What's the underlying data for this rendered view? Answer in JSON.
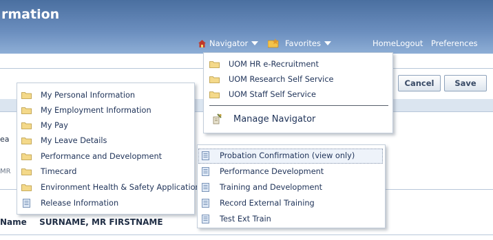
{
  "app_title": "rmation",
  "global_bar": {
    "navigator_label": "Navigator",
    "favorites_label": "Favorites",
    "home_label": "Home",
    "logout_label": "Logout",
    "preferences_label": "Preferences"
  },
  "page": {
    "cancel_label": "Cancel",
    "save_label": "Save",
    "name_label": "Name",
    "name_value": "SURNAME, MR FIRSTNAME",
    "left_fragment_1": "ea",
    "left_fragment_2": "MR"
  },
  "navigator_menu": {
    "items": [
      {
        "label": "UOM HR e-Recruitment",
        "icon": "folder-icon"
      },
      {
        "label": "UOM Research Self Service",
        "icon": "folder-icon"
      },
      {
        "label": "UOM Staff Self Service",
        "icon": "folder-icon"
      }
    ],
    "manage_label": "Manage Navigator",
    "manage_icon": "manage-navigator-icon"
  },
  "staff_menu": {
    "items": [
      {
        "label": "My Personal Information",
        "icon": "folder-icon"
      },
      {
        "label": "My Employment Information",
        "icon": "folder-icon"
      },
      {
        "label": "My Pay",
        "icon": "folder-icon"
      },
      {
        "label": "My Leave Details",
        "icon": "folder-icon"
      },
      {
        "label": "Performance and Development",
        "icon": "folder-icon"
      },
      {
        "label": "Timecard",
        "icon": "folder-icon"
      },
      {
        "label": "Environment Health & Safety Applications",
        "icon": "folder-icon"
      },
      {
        "label": "Release Information",
        "icon": "page-icon"
      }
    ]
  },
  "perf_menu": {
    "items": [
      {
        "label": "Probation Confirmation (view only)",
        "icon": "page-icon",
        "hovered": true
      },
      {
        "label": "Performance Development",
        "icon": "page-icon"
      },
      {
        "label": "Training and Development",
        "icon": "page-icon"
      },
      {
        "label": "Record External Training",
        "icon": "page-icon"
      },
      {
        "label": "Test Ext Train",
        "icon": "page-icon"
      }
    ]
  },
  "colors": {
    "header_top": "#4a6fa0",
    "header_bottom": "#8eaed6",
    "menu_text": "#1d3157",
    "folder": "#f2d58b"
  }
}
